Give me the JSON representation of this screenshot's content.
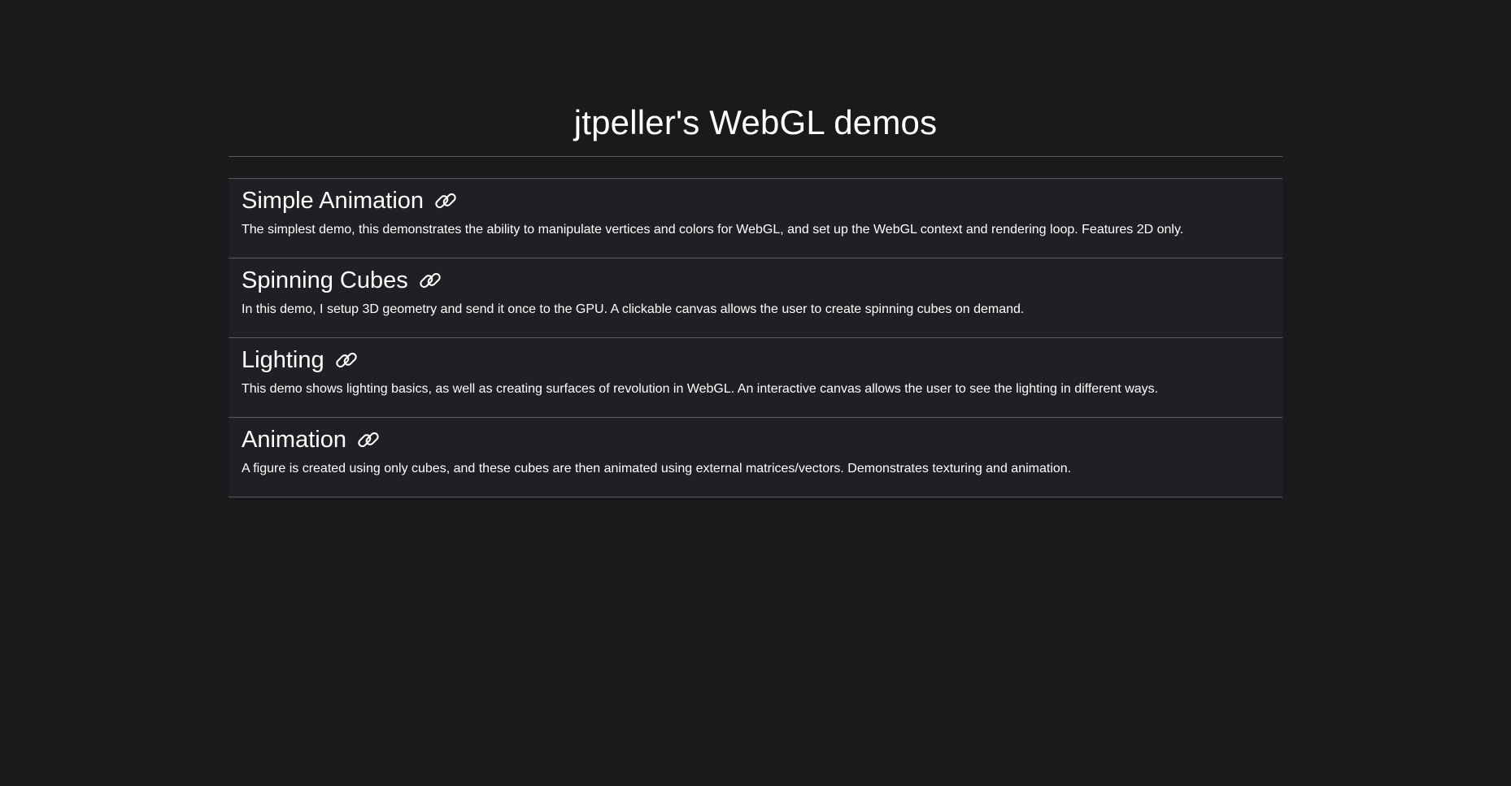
{
  "header": {
    "title": "jtpeller's WebGL demos"
  },
  "demos": [
    {
      "title": "Simple Animation",
      "icon": "link-icon",
      "description": "The simplest demo, this demonstrates the ability to manipulate vertices and colors for WebGL, and set up the WebGL context and rendering loop. Features 2D only."
    },
    {
      "title": "Spinning Cubes",
      "icon": "link-icon",
      "description": "In this demo, I setup 3D geometry and send it once to the GPU. A clickable canvas allows the user to create spinning cubes on demand."
    },
    {
      "title": "Lighting",
      "icon": "link-icon",
      "description": "This demo shows lighting basics, as well as creating surfaces of revolution in WebGL. An interactive canvas allows the user to see the lighting in different ways."
    },
    {
      "title": "Animation",
      "icon": "link-icon",
      "description": "A figure is created using only cubes, and these cubes are then animated using external matrices/vectors. Demonstrates texturing and animation."
    }
  ],
  "colors": {
    "background": "#1a1a1c",
    "card_background": "#1f2024",
    "divider": "#5a5a5e",
    "text": "#ffffff"
  }
}
